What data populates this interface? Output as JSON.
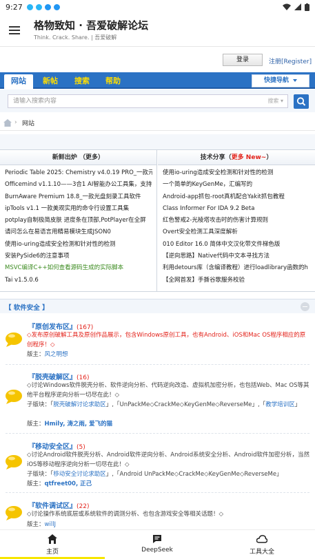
{
  "status_bar": {
    "time": "9:27"
  },
  "app": {
    "title": "格物致知 · 吾爱破解论坛",
    "subtitle": "Think. Crack. Share. | 吾爱破解"
  },
  "auth": {
    "login_label": "登录",
    "register_label": "注册[Register]"
  },
  "nav": {
    "tabs": [
      {
        "label": "网站"
      },
      {
        "label": "新帖"
      },
      {
        "label": "搜索"
      },
      {
        "label": "帮助"
      }
    ],
    "quick_nav_label": "快捷导航"
  },
  "search": {
    "placeholder": "请输入搜索内容",
    "type_label": "搜索"
  },
  "breadcrumb": {
    "sep": "›",
    "current": "网站"
  },
  "hot": {
    "left_title": "新鲜出炉 （更多）",
    "right_title_prefix": "技术分享（",
    "right_title_more": "更多 New~",
    "right_title_suffix": "）",
    "left_items": [
      "Periodic Table 2025: Chemistry v4.0.19 PRO_一款元",
      "Officemind v1.1.10——3合1 AI智能办公工具集，支持",
      "BurnAware Premium 18.8_一款光盘刻录工具软件",
      "ipTools v1.1 一款美观实用的命令行设置工具集",
      "potplay自制极简皮肤 进度条在顶部,PotPlayer在全屏",
      "请问怎么在易语言用精易模块生成JSON0",
      "使用io-uring造成安全检测和针对性的检测",
      "安装PySide6的注意事项",
      "MSVC编译C++如何查看源码生成的实际脚本",
      "Tai v1.5.0.6"
    ],
    "right_items": [
      "使用io-uring造成安全检测和针对性的检测",
      "一个简单的KeyGenMe，汇编写的",
      "Android-app抓包-root真机配合Yakit抓包教程",
      "Class Informer For IDA 9.2 Beta",
      "红色警戒2-光棱塔攻击时的伤害计算规则",
      "Overt安全检测工具深度解析",
      "010 Editor 16.0 简体中文汉化带文件梯色版",
      "【逆向思路】Native代码中文本寻找方法",
      "利用detours库（含编译教程）进行loadlibrary函数的h",
      "【全网首发】手撕谷歌服务校验"
    ]
  },
  "section": {
    "title": "【 软件安全 】"
  },
  "forums": [
    {
      "name": "『原创发布区』",
      "count": "(167)",
      "desc": "◇发布原创破解工具及原创作品展示，包含Windows原创工具，也有Android、iOS和Mac OS程序相应的原创程序！◇",
      "moderator_label": "版主：",
      "moderators": "风之明想"
    },
    {
      "name": "『脱壳破解区』",
      "count": "(16)",
      "desc": "◇讨论Windows软件脱壳分析、软件逆向分析、代码逆向改造、虚拟机加密分析，也包括Web、Mac OS等其他平台程序逆向分析一切尽在此！◇",
      "subforum_label": "子版块：",
      "subforums": [
        "脱壳破解讨论求助区",
        "UnPackMe◇CrackMe◇KeyGenMe◇ReverseMe",
        "教学培训区"
      ],
      "moderator_label": "版主：",
      "moderators": "Hmily, 涛之雨, 爱飞的猫"
    },
    {
      "name": "『移动安全区』",
      "count": "(5)",
      "desc": "◇讨论Android软件脱壳分析、Android软件逆向分析、Android系统安全分析、Android软件加密分析，当然iOS等移动程序逆向分析一切尽在此！◇",
      "subforum_label": "子版块：",
      "subforums": [
        "移动安全讨论求助区",
        "Android UnPackMe◇CrackMe◇KeyGenMe◇ReverseMe"
      ],
      "moderator_label": "版主：",
      "moderators": "qtfreet00, 正己"
    },
    {
      "name": "『软件调试区』",
      "count": "(22)",
      "desc": "◇讨论操作系统底层或系统软件的调测分析、也包含游戏安全等相关话题！◇",
      "moderator_label": "版主：",
      "moderators": "willJ"
    }
  ],
  "bottom_nav": [
    {
      "label": "主页",
      "icon": "home-icon"
    },
    {
      "label": "DeepSeek",
      "icon": "chat-icon"
    },
    {
      "label": "工具大全",
      "icon": "cloud-icon"
    }
  ],
  "colors": {
    "brand": "#2b72c4",
    "accent_yellow": "#ffde00",
    "hot_red": "#e3231b"
  }
}
